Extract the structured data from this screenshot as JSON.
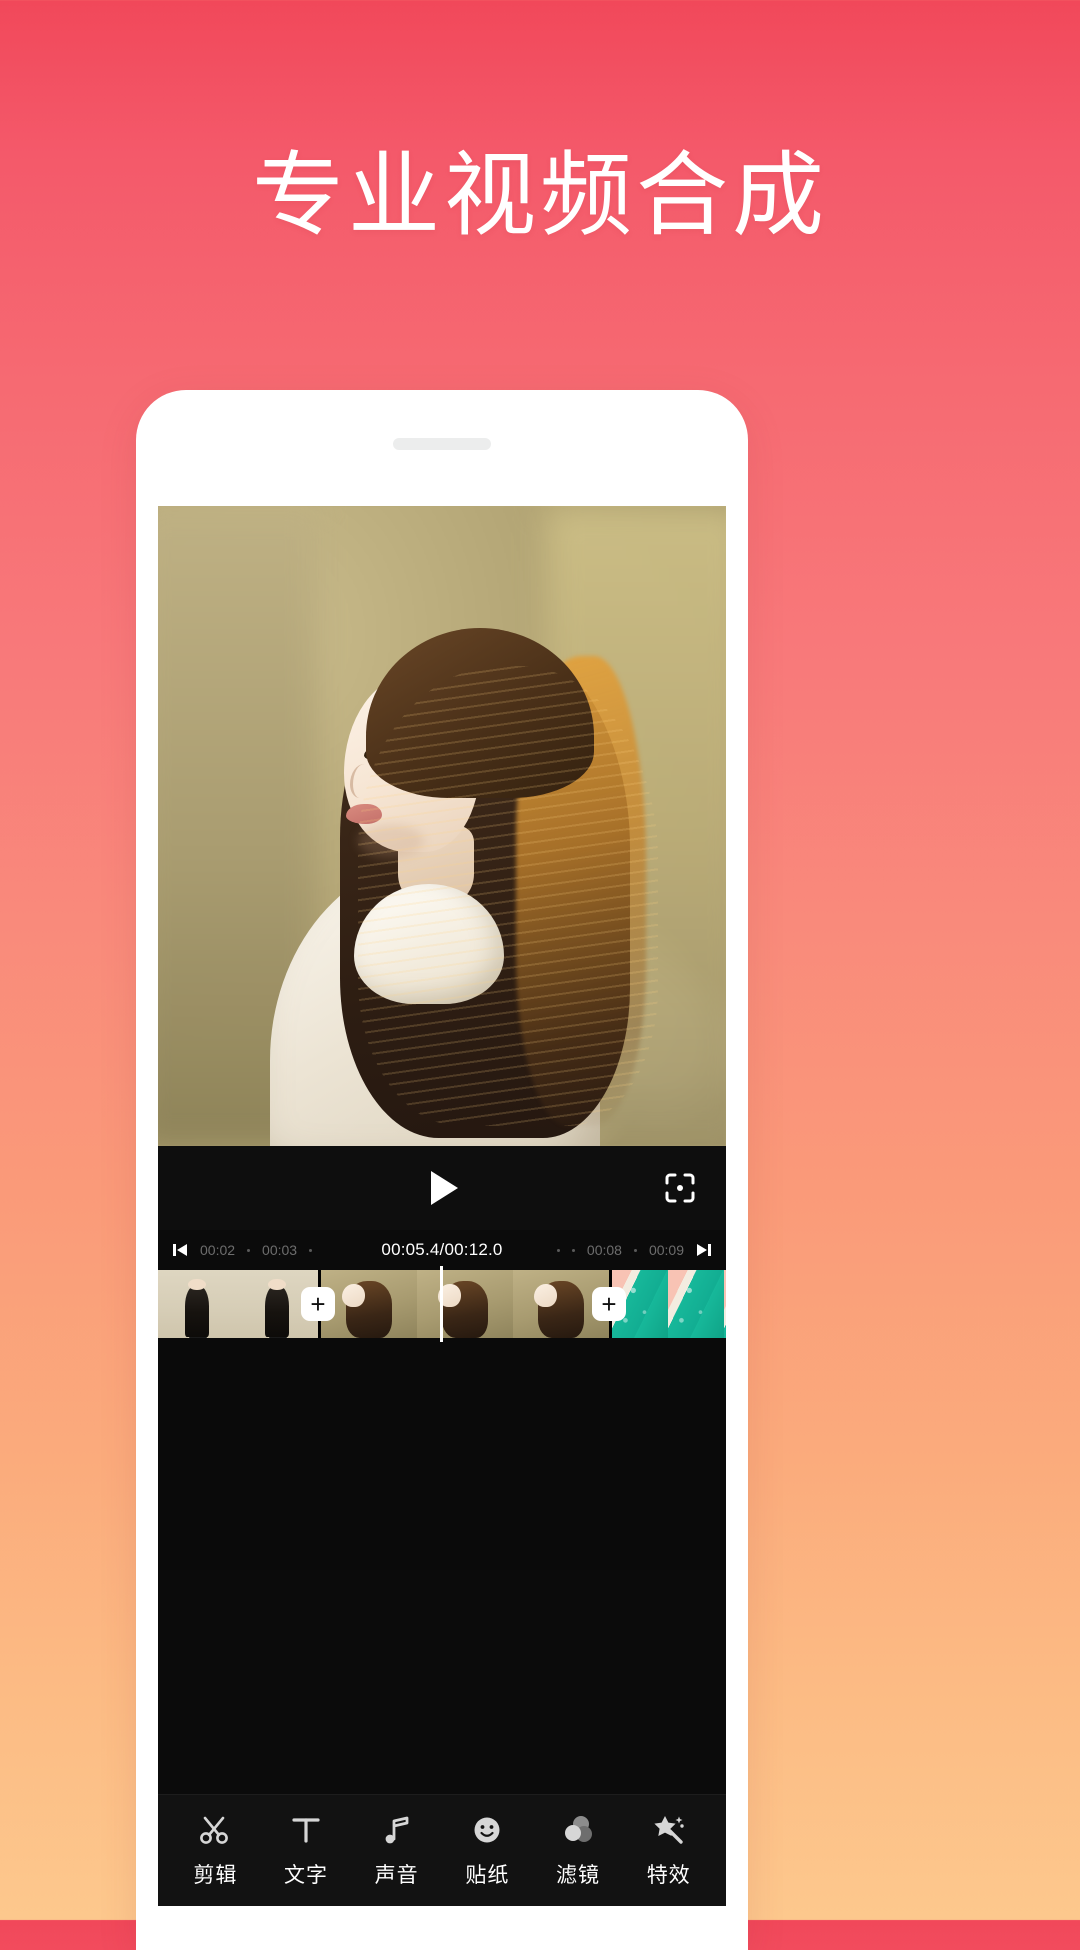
{
  "page": {
    "headline": "专业视频合成",
    "bg_top_color": "#f1485a",
    "bg_bottom_color": "#fdc88d"
  },
  "phone": {
    "speaker_name": "earpiece-speaker"
  },
  "editor": {
    "preview": {
      "description": "woman-with-long-hair-outdoor-video-frame"
    },
    "player": {
      "play_label": "▶",
      "fullscreen_label": "crop-frame"
    },
    "ruler": {
      "skip_start_label": "◀",
      "skip_end_label": "▶",
      "left_ticks": [
        "00:02",
        "00:03"
      ],
      "right_ticks": [
        "00:08",
        "00:09"
      ],
      "current_time": "00:05.4",
      "separator": "/",
      "total_time": "00:12.0",
      "timecode": "00:05.4/00:12.0"
    },
    "timeline": {
      "add_label": "+",
      "clips": [
        {
          "name": "clip-1",
          "frames": [
            "thumb-a",
            "thumb-a"
          ]
        },
        {
          "name": "clip-2",
          "frames": [
            "thumb-b",
            "thumb-b",
            "thumb-b"
          ]
        },
        {
          "name": "clip-3",
          "frames": [
            "thumb-c",
            "thumb-c",
            "thumb-c",
            "thumb-c"
          ]
        },
        {
          "name": "clip-4",
          "frames": [
            "thumb-d"
          ]
        }
      ]
    },
    "toolbar": {
      "items": [
        {
          "label": "剪辑",
          "icon": "scissors-icon"
        },
        {
          "label": "文字",
          "icon": "text-icon"
        },
        {
          "label": "声音",
          "icon": "music-note-icon"
        },
        {
          "label": "贴纸",
          "icon": "sticker-smiley-icon"
        },
        {
          "label": "滤镜",
          "icon": "filter-circles-icon"
        },
        {
          "label": "特效",
          "icon": "magic-wand-icon"
        }
      ]
    }
  }
}
